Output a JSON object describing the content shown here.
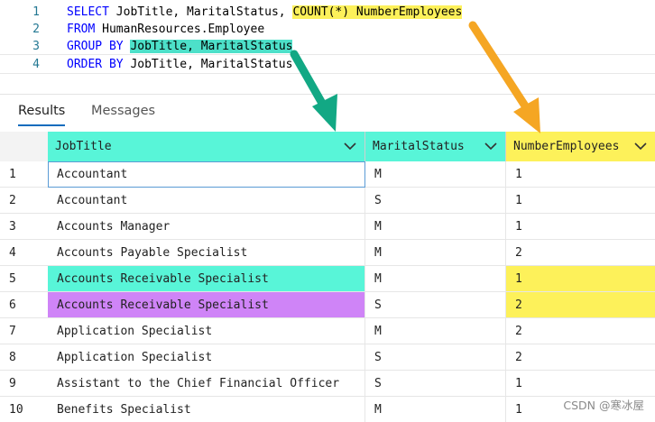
{
  "editor": {
    "lines": [
      {
        "num": "1",
        "parts": [
          {
            "text": "SELECT",
            "cls": "kw"
          },
          {
            "text": " JobTitle, MaritalStatus, ",
            "cls": "plain"
          },
          {
            "text": "COUNT(*) NumberEmployees",
            "cls": "plain hl-yellow"
          }
        ]
      },
      {
        "num": "2",
        "parts": [
          {
            "text": "FROM",
            "cls": "kw"
          },
          {
            "text": " HumanResources.Employee",
            "cls": "plain"
          }
        ]
      },
      {
        "num": "3",
        "parts": [
          {
            "text": "GROUP BY",
            "cls": "kw"
          },
          {
            "text": " ",
            "cls": "plain"
          },
          {
            "text": "JobTitle, MaritalStatus",
            "cls": "plain hl-teal"
          }
        ]
      },
      {
        "num": "4",
        "parts": [
          {
            "text": "ORDER BY",
            "cls": "kw"
          },
          {
            "text": " JobTitle, MaritalStatus",
            "cls": "plain"
          }
        ]
      }
    ]
  },
  "tabs": {
    "results": "Results",
    "messages": "Messages"
  },
  "grid": {
    "columns": [
      "JobTitle",
      "MaritalStatus",
      "NumberEmployees"
    ],
    "rows": [
      {
        "num": "1",
        "job": "Accountant",
        "marital": "M",
        "count": "1",
        "style": "normal"
      },
      {
        "num": "2",
        "job": "Accountant",
        "marital": "S",
        "count": "1",
        "style": "normal"
      },
      {
        "num": "3",
        "job": "Accounts Manager",
        "marital": "M",
        "count": "1",
        "style": "normal"
      },
      {
        "num": "4",
        "job": "Accounts Payable Specialist",
        "marital": "M",
        "count": "2",
        "style": "normal"
      },
      {
        "num": "5",
        "job": "Accounts Receivable Specialist",
        "marital": "M",
        "count": "1",
        "style": "teal"
      },
      {
        "num": "6",
        "job": "Accounts Receivable Specialist",
        "marital": "S",
        "count": "2",
        "style": "purple"
      },
      {
        "num": "7",
        "job": "Application Specialist",
        "marital": "M",
        "count": "2",
        "style": "normal"
      },
      {
        "num": "8",
        "job": "Application Specialist",
        "marital": "S",
        "count": "2",
        "style": "normal"
      },
      {
        "num": "9",
        "job": "Assistant to the Chief Financial Officer",
        "marital": "S",
        "count": "1",
        "style": "normal"
      },
      {
        "num": "10",
        "job": "Benefits Specialist",
        "marital": "M",
        "count": "1",
        "style": "normal"
      }
    ]
  },
  "colors": {
    "teal": "#58f5d8",
    "purple": "#cf84f7",
    "yellow": "#fdf15a",
    "arrow_teal": "#12a884",
    "arrow_orange": "#f5a623"
  },
  "watermark": "CSDN @寒冰屋"
}
